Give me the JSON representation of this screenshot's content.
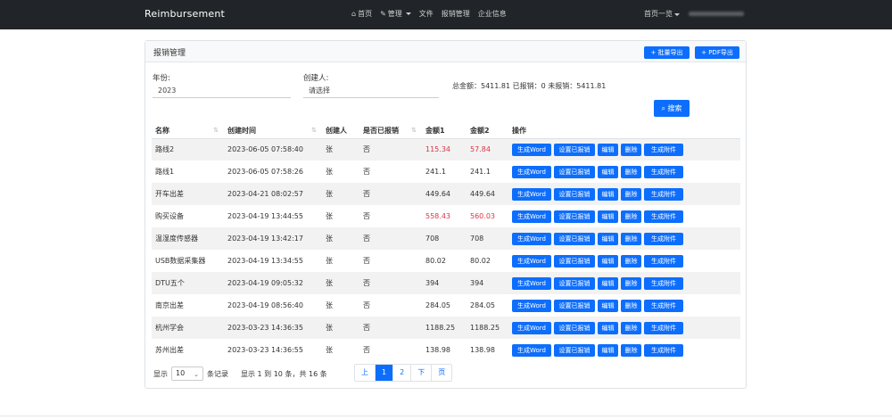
{
  "nav": {
    "brand": "Reimbursement",
    "items": [
      "首页",
      "管理",
      "文件",
      "报销管理",
      "企业信息"
    ],
    "user_label": "首页一览"
  },
  "card": {
    "title": "报销管理",
    "export_word": "+ 批量导出",
    "export_pdf": "+ PDF导出"
  },
  "filters": {
    "year_label": "年份:",
    "year_value": "2023",
    "creator_label": "创建人:",
    "creator_value": "请选择",
    "stats": "总金额：5411.81 已报销：0 未报销：5411.81",
    "search_label": "搜索"
  },
  "table": {
    "headers": [
      "名称",
      "创建时间",
      "创建人",
      "是否已报销",
      "金额1",
      "金额2",
      "操作"
    ],
    "rows": [
      {
        "name": "路线2",
        "time": "2023-06-05 07:58:40",
        "creator": "张",
        "done": "否",
        "amt1": "115.34",
        "amt2": "57.84",
        "highlight": true
      },
      {
        "name": "路线1",
        "time": "2023-06-05 07:58:26",
        "creator": "张",
        "done": "否",
        "amt1": "241.1",
        "amt2": "241.1",
        "highlight": false
      },
      {
        "name": "开车出差",
        "time": "2023-04-21 08:02:57",
        "creator": "张",
        "done": "否",
        "amt1": "449.64",
        "amt2": "449.64",
        "highlight": false
      },
      {
        "name": "购买设备",
        "time": "2023-04-19 13:44:55",
        "creator": "张",
        "done": "否",
        "amt1": "558.43",
        "amt2": "560.03",
        "highlight": true
      },
      {
        "name": "温湿度传感器",
        "time": "2023-04-19 13:42:17",
        "creator": "张",
        "done": "否",
        "amt1": "708",
        "amt2": "708",
        "highlight": false
      },
      {
        "name": "USB数据采集器",
        "time": "2023-04-19 13:34:55",
        "creator": "张",
        "done": "否",
        "amt1": "80.02",
        "amt2": "80.02",
        "highlight": false
      },
      {
        "name": "DTU五个",
        "time": "2023-04-19 09:05:32",
        "creator": "张",
        "done": "否",
        "amt1": "394",
        "amt2": "394",
        "highlight": false
      },
      {
        "name": "南京出差",
        "time": "2023-04-19 08:56:40",
        "creator": "张",
        "done": "否",
        "amt1": "284.05",
        "amt2": "284.05",
        "highlight": false
      },
      {
        "name": "杭州学会",
        "time": "2023-03-23 14:36:35",
        "creator": "张",
        "done": "否",
        "amt1": "1188.25",
        "amt2": "1188.25",
        "highlight": false
      },
      {
        "name": "苏州出差",
        "time": "2023-03-23 14:36:55",
        "creator": "张",
        "done": "否",
        "amt1": "138.98",
        "amt2": "138.98",
        "highlight": false
      }
    ],
    "ops": [
      "生成Word",
      "设置已报销",
      "编辑",
      "删除",
      "生成附件"
    ]
  },
  "footer": {
    "show_label": "显示",
    "page_size": "10",
    "per_page": "条记录",
    "summary": "显示 1 到 10 条，共 16 条",
    "pager": [
      "上",
      "1",
      "2",
      "下",
      "页"
    ]
  },
  "colors": {
    "primary": "#0d6efd",
    "navbar": "#212529",
    "red": "#dc3545"
  }
}
